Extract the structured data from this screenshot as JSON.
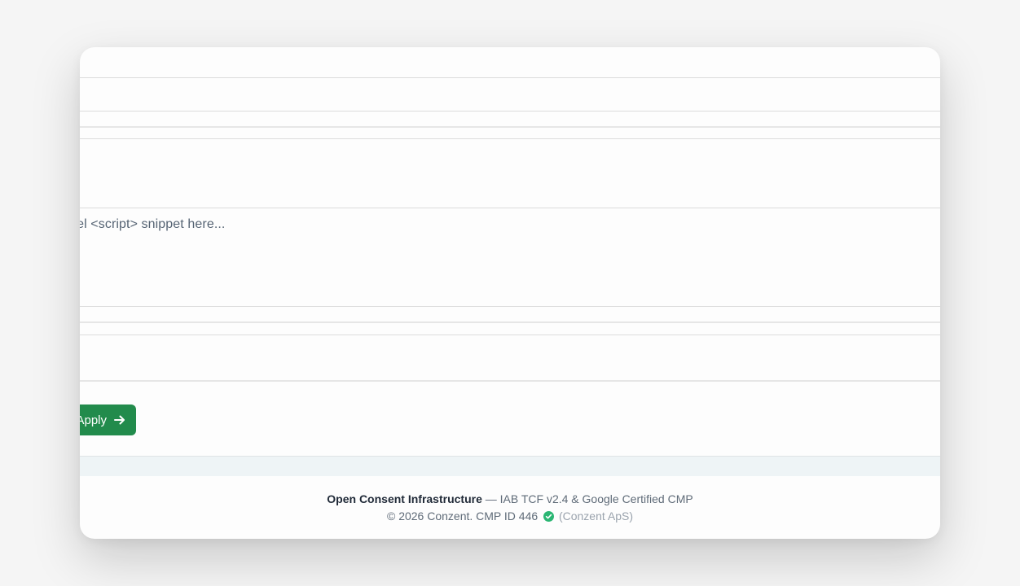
{
  "form": {
    "pixel_textarea_placeholder": "xel <script> snippet here..."
  },
  "actions": {
    "apply_label": "Apply"
  },
  "footer": {
    "brand": "Open Consent Infrastructure",
    "tagline": " — IAB TCF v2.4 & Google Certified CMP",
    "copyright": "© 2026 Conzent. CMP ID 446",
    "company": "(Conzent ApS)"
  },
  "colors": {
    "accent": "#228b4c",
    "check": "#2bb673"
  },
  "icons": {
    "apply": "arrow-right-icon",
    "cmp_verified": "check-circle-icon"
  }
}
